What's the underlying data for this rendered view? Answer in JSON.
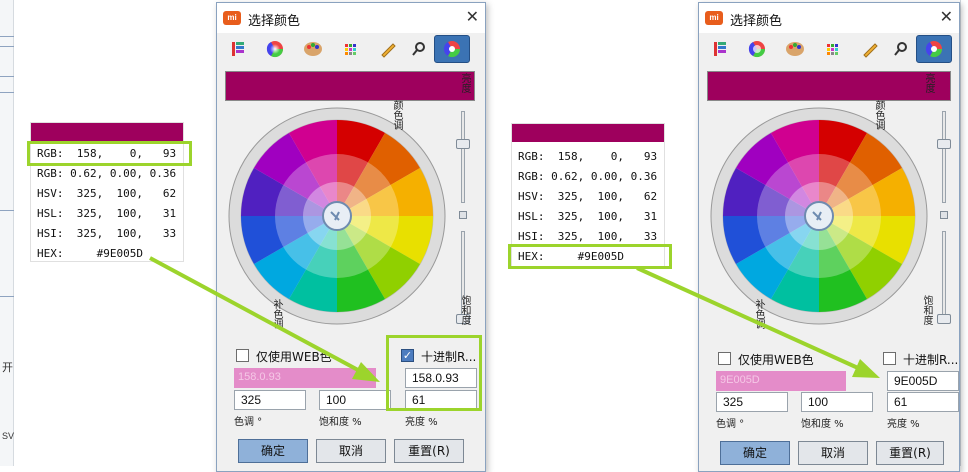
{
  "background": {
    "left_chars": [
      "开",
      "SV"
    ]
  },
  "colors": {
    "selected": "#9E005D",
    "highlight": "#9CD42C",
    "accent": "#3B73B4",
    "pink_field": "#E48CC9"
  },
  "dialog_left": {
    "title": "选择颜色",
    "app_icon_text": "mi",
    "toolbar": [
      "palette-list-icon",
      "color-wheel-icon",
      "paint-palette-icon",
      "grid-icon",
      "pencil-icon",
      "magnifier-icon",
      "color-picker-icon"
    ],
    "wheel_labels": {
      "top_right": "颜色调",
      "bottom_left": "补色调"
    },
    "slider_labels": {
      "top": "亮度",
      "bottom": "饱和度"
    },
    "web_only_label": "仅使用WEB色",
    "decimal_label": "十进制R...",
    "decimal_checked": true,
    "pink_value": "158.0.93",
    "decimal_value": "158.0.93",
    "hue": "325",
    "saturation": "100",
    "brightness": "61",
    "hue_label": "色调 °",
    "sat_label": "饱和度 %",
    "bright_label": "亮度 %",
    "ok": "确定",
    "cancel": "取消",
    "reset": "重置(R)"
  },
  "dialog_right": {
    "title": "选择颜色",
    "app_icon_text": "mi",
    "toolbar": [
      "palette-list-icon",
      "color-wheel-icon",
      "paint-palette-icon",
      "grid-icon",
      "pencil-icon",
      "magnifier-icon",
      "color-picker-icon"
    ],
    "wheel_labels": {
      "top_right": "颜色调",
      "bottom_left": "补色调"
    },
    "slider_labels": {
      "top": "亮度",
      "bottom": "饱和度"
    },
    "web_only_label": "仅使用WEB色",
    "decimal_label": "十进制R...",
    "decimal_checked": false,
    "pink_value": "9E005D",
    "decimal_value": "9E005D",
    "hue": "325",
    "saturation": "100",
    "brightness": "61",
    "hue_label": "色调 °",
    "sat_label": "饱和度 %",
    "bright_label": "亮度 %",
    "ok": "确定",
    "cancel": "取消",
    "reset": "重置(R)"
  },
  "info_left": {
    "rows": [
      "RGB:  158,    0,   93",
      "RGB: 0.62, 0.00, 0.36",
      "HSV:  325,  100,   62",
      "HSL:  325,  100,   31",
      "HSI:  325,  100,   33",
      "HEX:     #9E005D"
    ]
  },
  "info_right": {
    "rows": [
      "RGB:  158,    0,   93",
      "RGB: 0.62, 0.00, 0.36",
      "HSV:  325,  100,   62",
      "HSL:  325,  100,   31",
      "HSI:  325,  100,   33",
      "HEX:     #9E005D"
    ]
  }
}
